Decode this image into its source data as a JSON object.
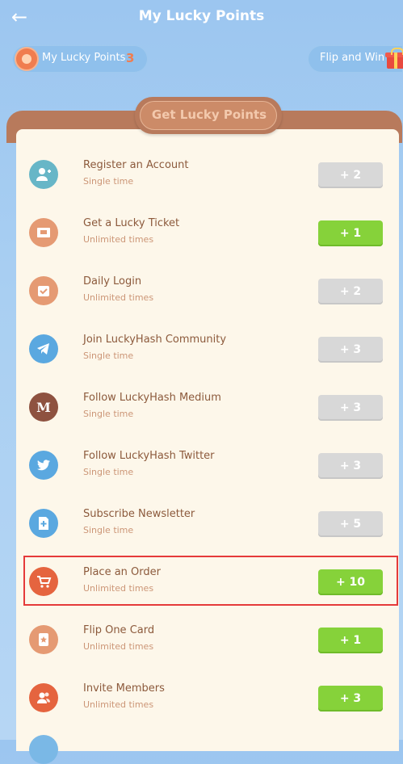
{
  "header": {
    "title": "My Lucky Points",
    "back_icon": "arrow-left-icon"
  },
  "chips": {
    "my_points_label": "My Lucky Points",
    "my_points_count": "3",
    "flip_label": "Flip and Win"
  },
  "section_title": "Get Lucky Points",
  "colors": {
    "disabled": "#d8d8d8",
    "active": "#86d23a",
    "highlight": "#e53a3a"
  },
  "tasks": [
    {
      "title": "Register an Account",
      "frequency": "Single time",
      "points": "+ 2",
      "state": "disabled",
      "icon": "add-user-icon",
      "icon_color": "#67b6c7"
    },
    {
      "title": "Get a Lucky Ticket",
      "frequency": "Unlimited times",
      "points": "+ 1",
      "state": "active",
      "icon": "ticket-icon",
      "icon_color": "#e59a73"
    },
    {
      "title": "Daily Login",
      "frequency": "Unlimited times",
      "points": "+ 2",
      "state": "disabled",
      "icon": "calendar-check-icon",
      "icon_color": "#e59a73"
    },
    {
      "title": "Join LuckyHash Community",
      "frequency": "Single time",
      "points": "+ 3",
      "state": "disabled",
      "icon": "telegram-icon",
      "icon_color": "#5aa8e0"
    },
    {
      "title": "Follow LuckyHash Medium",
      "frequency": "Single time",
      "points": "+ 3",
      "state": "disabled",
      "icon": "medium-icon",
      "icon_color": "#8e5240"
    },
    {
      "title": "Follow LuckyHash Twitter",
      "frequency": "Single time",
      "points": "+ 3",
      "state": "disabled",
      "icon": "twitter-icon",
      "icon_color": "#5aa8e0"
    },
    {
      "title": "Subscribe Newsletter",
      "frequency": "Single time",
      "points": "+ 5",
      "state": "disabled",
      "icon": "newsletter-icon",
      "icon_color": "#5aa8e0"
    },
    {
      "title": "Place an Order",
      "frequency": "Unlimited times",
      "points": "+ 10",
      "state": "active",
      "icon": "cart-icon",
      "icon_color": "#e5643f"
    },
    {
      "title": "Flip One Card",
      "frequency": "Unlimited times",
      "points": "+ 1",
      "state": "active",
      "icon": "card-icon",
      "icon_color": "#e59a73"
    },
    {
      "title": "Invite Members",
      "frequency": "Unlimited times",
      "points": "+ 3",
      "state": "active",
      "icon": "members-icon",
      "icon_color": "#e5643f"
    }
  ]
}
